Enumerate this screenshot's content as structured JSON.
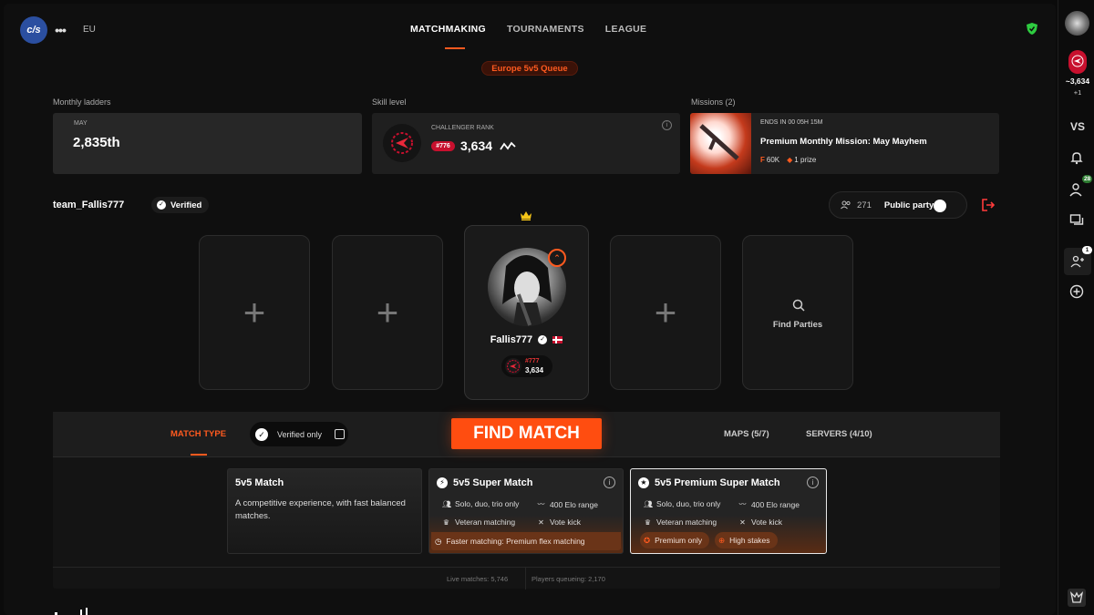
{
  "header": {
    "logo_text": "c/s",
    "more_label": "•••",
    "region": "EU",
    "nav": [
      {
        "label": "MATCHMAKING",
        "active": true
      },
      {
        "label": "TOURNAMENTS",
        "active": false
      },
      {
        "label": "LEAGUE",
        "active": false
      }
    ],
    "queue_label": "Europe 5v5 Queue"
  },
  "stats": {
    "ladders_label": "Monthly ladders",
    "ladders_month": "MAY",
    "ladders_rank": "2,835th",
    "skill_label": "Skill level",
    "skill_rank_name": "CHALLENGER RANK",
    "skill_rank_position": "#776",
    "skill_elo": "3,634",
    "missions_label": "Missions (2)",
    "mission_timer": "ENDS IN 00 05H 15M",
    "mission_title": "Premium Monthly Mission: May Mayhem",
    "mission_reward_points": "60K",
    "mission_reward_prize": "1 prize"
  },
  "party": {
    "team_name": "team_Fallis777",
    "verified_label": "Verified",
    "party_count": "271",
    "public_party_label": "Public party",
    "find_parties_label": "Find Parties",
    "player": {
      "name": "Fallis777",
      "rank_position": "#777",
      "elo": "3,634",
      "country": "Denmark"
    }
  },
  "match": {
    "match_type_label": "MATCH TYPE",
    "verified_only_label": "Verified only",
    "find_match_label": "FIND MATCH",
    "maps_label": "MAPS (5/7)",
    "servers_label": "SERVERS (4/10)",
    "cards": [
      {
        "title": "5v5 Match",
        "description": "A competitive experience, with fast balanced matches."
      },
      {
        "title": "5v5 Super Match",
        "features": [
          "Solo, duo, trio only",
          "400 Elo range",
          "Veteran matching",
          "Vote kick"
        ],
        "highlight": "Faster matching: Premium flex matching"
      },
      {
        "title": "5v5 Premium Super Match",
        "features": [
          "Solo, duo, trio only",
          "400 Elo range",
          "Veteran matching",
          "Vote kick"
        ],
        "highlights": [
          "Premium only",
          "High stakes"
        ]
      }
    ],
    "live_matches": "Live matches: 5,746",
    "players_queueing": "Players queueing: 2,170"
  },
  "sidebar": {
    "elo": "~3,634",
    "elo_delta": "+1",
    "vs_label": "VS",
    "friends_count": "28",
    "party_invites_count": "1"
  },
  "colors": {
    "accent": "#ff4d10",
    "rank_red": "#c8102e",
    "background": "#0f0f0f"
  }
}
